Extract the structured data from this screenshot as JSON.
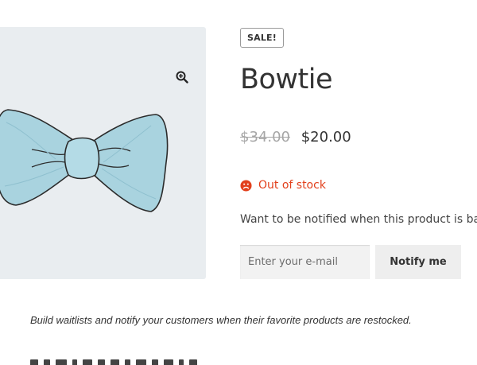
{
  "product": {
    "badge": "SALE!",
    "title": "Bowtie",
    "regular_price": "$34.00",
    "sale_price": "$20.00",
    "stock_status": "Out of stock",
    "notify_prompt": "Want to be notified when this product is back in stock?"
  },
  "gallery": {
    "image_icon": "bowtie-image",
    "zoom_icon": "zoom-in-icon"
  },
  "stock_icon": "sad-face-icon",
  "waitlist_form": {
    "email_placeholder": "Enter your e-mail",
    "email_value": "",
    "button_label": "Notify me"
  },
  "footer_note": "Build waitlists and notify your customers when their favorite products are restocked.",
  "colors": {
    "accent_red": "#e2401c",
    "gallery_bg": "#e9edf0",
    "button_bg": "#eeeeee",
    "bowtie_fill": "#a9d3df"
  }
}
